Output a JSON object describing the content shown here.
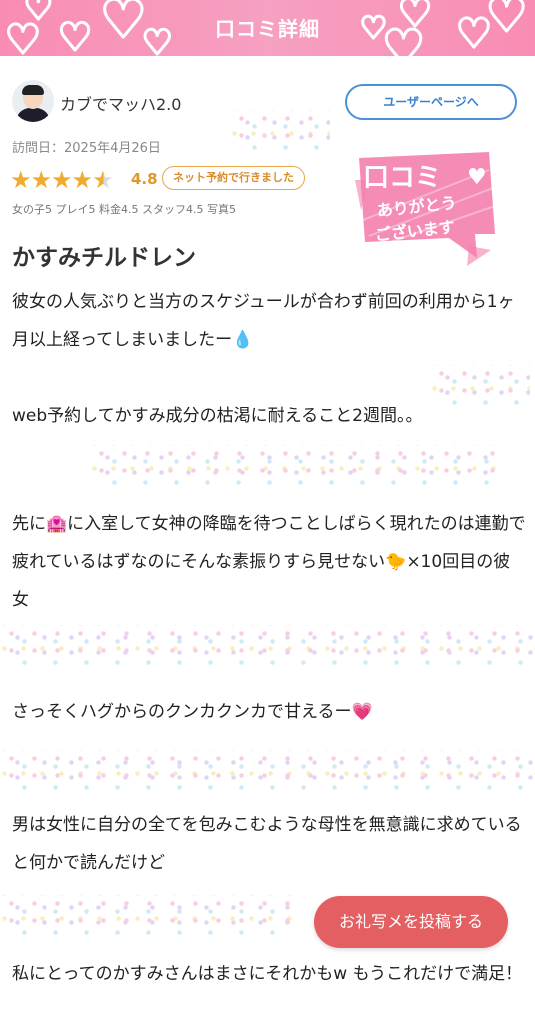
{
  "header": {
    "title": "口コミ詳細"
  },
  "reviewer": {
    "name": "カブでマッハ2.0",
    "user_page_label": "ユーザーページへ"
  },
  "visit_date": "訪問日：2025年4月26日",
  "rating": {
    "stars": 4.5,
    "score": "4.8",
    "badge": "ネット予約で行きました",
    "breakdown": "女の子5 プレイ5 料金4.5 スタッフ4.5 写真5"
  },
  "stamp": {
    "line1": "口コミ",
    "line2": "ありがとう",
    "line3": "ございます"
  },
  "review": {
    "title": "かすみチルドレン",
    "paragraphs": [
      "彼女の人気ぶりと当方のスケジュールが合わず前回の利用から1ヶ月以上経ってしまいましたー💧",
      "web予約してかすみ成分の枯渇に耐えること2週間。。",
      "先に🏩に入室して女神の降臨を待つことしばらく現れたのは連勤で疲れているはずなのにそんな素振りすら見せない🐤×10回目の彼女",
      "さっそくハグからのクンカクンカで甘えるー💗",
      "男は女性に自分の全てを包みこむような母性を無意識に求めていると何かで読んだけど",
      "私にとってのかすみさんはまさにそれかもw もうこれだけで満足！"
    ]
  },
  "post_photo_label": "お礼写メを投稿する",
  "colors": {
    "header": "#f98cb4",
    "accent": "#e45f62",
    "star": "#f0ac2e",
    "link": "#4d8fd6"
  },
  "icons": [
    "heart-icon",
    "star-icon",
    "droplet-emoji",
    "love-hotel-emoji",
    "chick-emoji",
    "sparkling-heart-emoji"
  ]
}
